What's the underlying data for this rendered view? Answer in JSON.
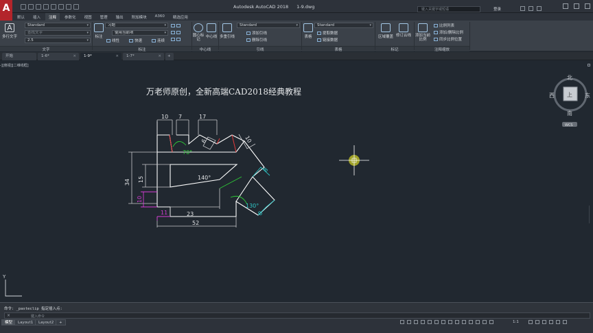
{
  "window": {
    "app": "Autodesk AutoCAD 2018",
    "file": "1-9.dwg",
    "search_placeholder": "键入关键字或短语",
    "user": "登录",
    "app_logo": "A"
  },
  "ribbon_tabs": [
    "默认",
    "插入",
    "注释",
    "参数化",
    "视图",
    "管理",
    "输出",
    "附加模块",
    "A360",
    "精选应用"
  ],
  "ribbon_active_tab": 2,
  "panels": {
    "text": {
      "title": "文字",
      "big_button": "多行文字",
      "style": "Standard",
      "find": "查找文字",
      "height": "2.5"
    },
    "dimension": {
      "title": "标注",
      "big_button": "标注",
      "style": "习题",
      "layer": "使用当前项",
      "b1": "线性",
      "b2": "快速",
      "b3": "连续"
    },
    "centerline": {
      "title": "中心线",
      "b1": "圆心标记",
      "b2": "中心线"
    },
    "leader": {
      "title": "引线",
      "big_button": "多重引线",
      "style": "Standard",
      "b1": "添加引线",
      "b2": "删除引线"
    },
    "table": {
      "title": "表格",
      "big_button": "表格",
      "style": "Standard",
      "b1": "提取数据",
      "b2": "链接数据"
    },
    "markup": {
      "title": "标记",
      "b1": "区域覆盖",
      "b2": "修订云线"
    },
    "scale": {
      "title": "注释缩放",
      "big_button": "添加当前比例",
      "b1": "比例列表",
      "b2": "添加/删除比例",
      "b3": "同步比例位置"
    }
  },
  "doc_tabs": [
    "开始",
    "1-6*",
    "1-9*",
    "1-7*"
  ],
  "doc_active": 2,
  "viewport_label": "-][俯视][二维线框]",
  "drawing": {
    "title": "万老师原创，全新高端CAD2018经典教程",
    "dims": {
      "d10a": "10",
      "d7": "7",
      "d17": "17",
      "d6": "6",
      "d10b": "10",
      "a70": "70°",
      "d34": "34",
      "d15": "15",
      "a140": "140°",
      "d10c": "10",
      "d11": "11",
      "d23": "23",
      "d52": "52",
      "a130": "130°",
      "d8a": "8",
      "d8b": "8"
    }
  },
  "viewcube": {
    "north": "北",
    "south": "南",
    "west": "西",
    "east": "东",
    "top": "上",
    "wcs": "WCS"
  },
  "ucs": {
    "y": "Y"
  },
  "command": {
    "history": "命令: _pasteclip 指定插入点:",
    "placeholder": "键入命令"
  },
  "layout_tabs": [
    "模型",
    "Layout1",
    "Layout2"
  ],
  "status": {
    "scale": "1:1"
  },
  "colors": {
    "background": "#212830",
    "geometry": "#ffffff",
    "dimension": "#c7c9cc",
    "green": "#2ecb37",
    "cyan": "#2fc8c8",
    "magenta": "#d63bd6",
    "red": "#e23a3a"
  }
}
